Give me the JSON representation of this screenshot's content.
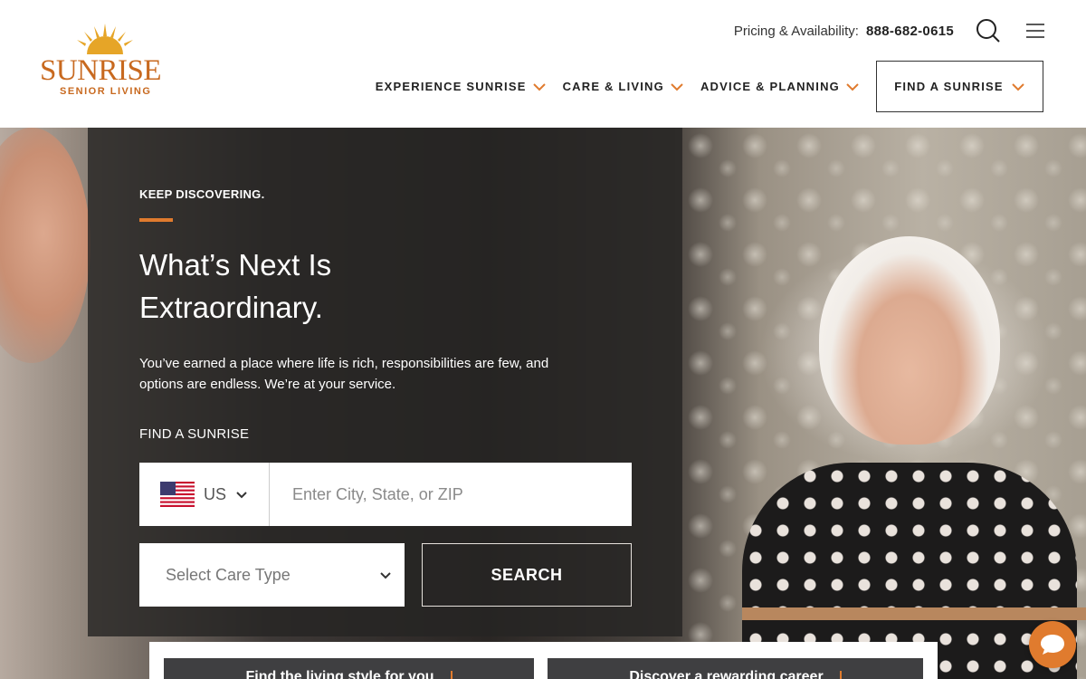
{
  "brand": {
    "name": "SUNRISE",
    "subtitle": "SENIOR LIVING",
    "accent": "#e07b2e",
    "logo_color": "#c8691f"
  },
  "header": {
    "pricing_label": "Pricing & Availability:",
    "phone": "888-682-0615",
    "search_icon": "search-icon",
    "menu_icon": "hamburger-menu-icon"
  },
  "nav": {
    "items": [
      {
        "label": "EXPERIENCE SUNRISE"
      },
      {
        "label": "CARE & LIVING"
      },
      {
        "label": "ADVICE & PLANNING"
      }
    ],
    "find_button": "FIND A SUNRISE"
  },
  "hero": {
    "kicker": "KEEP DISCOVERING.",
    "headline": "What’s Next Is Extraordinary.",
    "intro": "You’ve earned a place where life is rich, responsibilities are few, and options are endless. We’re at your service.",
    "find_label": "FIND A SUNRISE",
    "country": {
      "code": "US",
      "flag_icon": "us-flag-icon"
    },
    "location_placeholder": "Enter City, State, or ZIP",
    "care_type_placeholder": "Select Care Type",
    "search_button": "SEARCH"
  },
  "teasers": [
    {
      "label": "Find the living style for you"
    },
    {
      "label": "Discover a rewarding career"
    }
  ],
  "chat": {
    "icon": "chat-bubble-icon"
  }
}
